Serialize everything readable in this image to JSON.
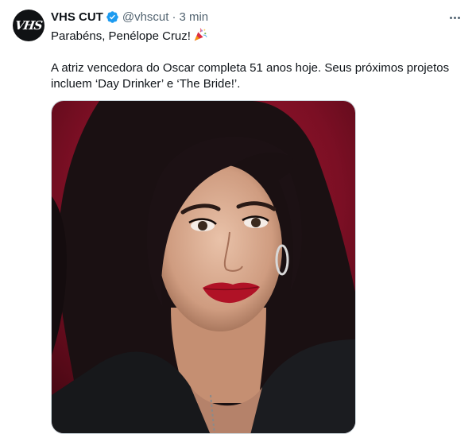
{
  "tweet": {
    "author_name": "VHS CUT",
    "avatar_text": "VHS",
    "handle": "@vhscut",
    "separator": "·",
    "time": "3 min",
    "line1": "Parabéns, Penélope Cruz!",
    "line2": "A atriz vencedora do Oscar completa 51 anos hoje. Seus próximos projetos",
    "line3": "incluem ‘Day Drinker’ e ‘The Bride!’.",
    "emoji": "party-popper-icon",
    "verified_icon": "verified-badge-icon",
    "more_icon": "more-options-icon"
  },
  "colors": {
    "verified_blue": "#1d9bf0",
    "secondary_text": "#536471",
    "photo_background": "#7b0f24"
  }
}
